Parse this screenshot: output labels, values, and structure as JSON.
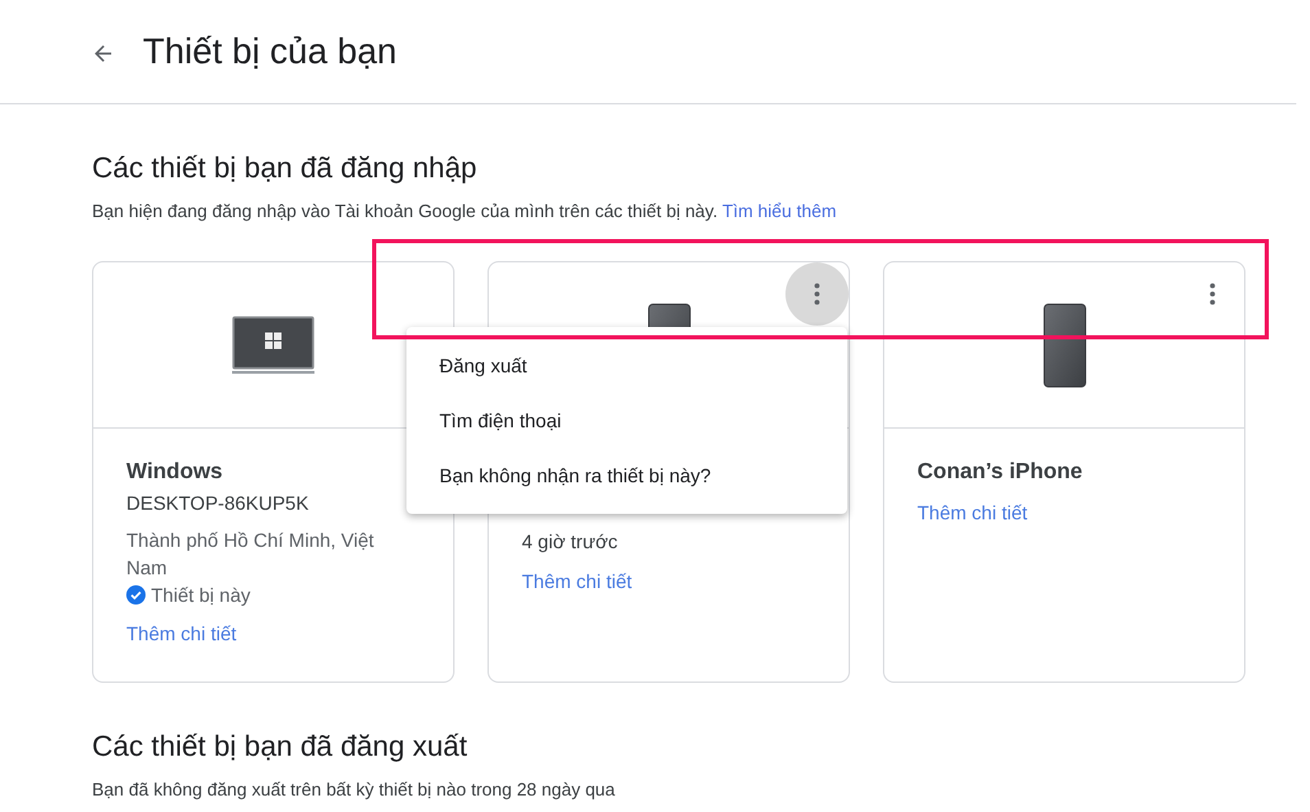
{
  "header": {
    "title": "Thiết bị của bạn"
  },
  "signed_in": {
    "heading": "Các thiết bị bạn đã đăng nhập",
    "description": "Bạn hiện đang đăng nhập vào Tài khoản Google của mình trên các thiết bị này.",
    "link": "Tìm hiểu thêm",
    "devices": [
      {
        "kind": "laptop",
        "lines": [
          {
            "kind": "title",
            "text": "Windows"
          },
          {
            "kind": "detail",
            "text": "DESKTOP-86KUP5K"
          },
          {
            "kind": "location",
            "text": "Thành phố Hồ Chí Minh, Việt Nam"
          },
          {
            "kind": "status",
            "text": "Thiết bị này"
          },
          {
            "kind": "link",
            "text": "Thêm chi tiết"
          }
        ]
      },
      {
        "kind": "phone",
        "menu_button": {
          "active": true
        },
        "lines": [
          {
            "kind": "detail",
            "text": "4 giờ trước"
          },
          {
            "kind": "link",
            "text": "Thêm chi tiết"
          }
        ]
      },
      {
        "kind": "phone",
        "menu_button": {
          "active": false
        },
        "lines": [
          {
            "kind": "title",
            "text": "Conan’s iPhone"
          },
          {
            "kind": "link",
            "text": "Thêm chi tiết"
          }
        ]
      }
    ]
  },
  "menu": {
    "items": [
      "Đăng xuất",
      "Tìm điện thoại",
      "Bạn không nhận ra thiết bị này?"
    ]
  },
  "signed_out": {
    "heading": "Các thiết bị bạn đã đăng xuất",
    "description": "Bạn đã không đăng xuất trên bất kỳ thiết bị nào trong 28 ngày qua"
  }
}
